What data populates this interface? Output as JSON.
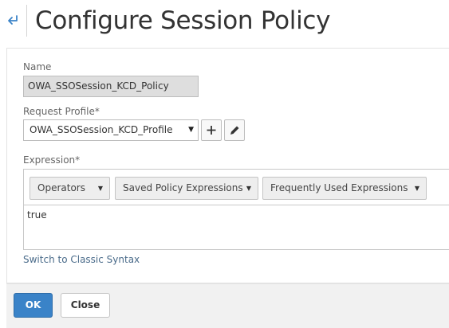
{
  "header": {
    "title": "Configure Session Policy",
    "back_icon": "back-arrow-icon"
  },
  "form": {
    "name_label": "Name",
    "name_value": "OWA_SSOSession_KCD_Policy",
    "request_profile_label": "Request Profile*",
    "request_profile_value": "OWA_SSOSession_KCD_Profile",
    "add_icon": "plus-icon",
    "edit_icon": "pencil-icon",
    "expression_label": "Expression*",
    "expression_toolbar": {
      "operators_label": "Operators",
      "saved_label": "Saved Policy Expressions",
      "frequent_label": "Frequently Used Expressions"
    },
    "expression_value": "true",
    "switch_link": "Switch to Classic Syntax"
  },
  "footer": {
    "ok_label": "OK",
    "close_label": "Close"
  },
  "colors": {
    "primary": "#3a83c8",
    "link": "#4a6b8a"
  }
}
